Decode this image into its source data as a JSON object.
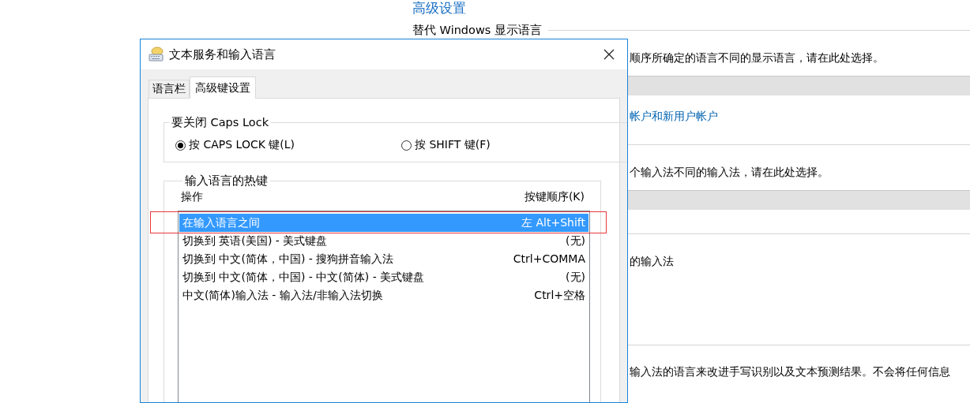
{
  "background_page": {
    "heading": "高级设置",
    "section_title": "替代 Windows 显示语言",
    "items": [
      {
        "kind": "text",
        "text": "顺序所确定的语言不同的显示语言，请在此处选择。"
      },
      {
        "kind": "band"
      },
      {
        "kind": "link",
        "text": "帐户和新用户帐户"
      },
      {
        "kind": "rule"
      },
      {
        "kind": "text",
        "text": "个输入法不同的输入法，请在此处选择。"
      },
      {
        "kind": "band"
      },
      {
        "kind": "rule"
      },
      {
        "kind": "text",
        "text": "的输入法"
      },
      {
        "kind": "rule"
      },
      {
        "kind": "text",
        "text": "输入法的语言来改进手写识别以及文本预测结果。不会将任何信息"
      }
    ]
  },
  "dialog": {
    "title": "文本服务和输入语言",
    "tabs": [
      {
        "label": "语言栏",
        "selected": false
      },
      {
        "label": "高级键设置",
        "selected": true
      }
    ],
    "caps_lock_group": {
      "title": "要关闭 Caps Lock",
      "options": [
        {
          "label": "按 CAPS LOCK 键(L)",
          "selected": true
        },
        {
          "label": "按 SHIFT 键(F)",
          "selected": false
        }
      ]
    },
    "hotkeys_group": {
      "title": "输入语言的热键",
      "columns": [
        "操作",
        "按键顺序(K)"
      ],
      "rows": [
        {
          "action": "在输入语言之间",
          "keys": "左 Alt+Shift",
          "selected": true
        },
        {
          "action": "切换到 英语(美国) - 美式键盘",
          "keys": "(无)",
          "selected": false
        },
        {
          "action": "切换到 中文(简体，中国) - 搜狗拼音输入法",
          "keys": "Ctrl+COMMA",
          "selected": false
        },
        {
          "action": "切换到 中文(简体，中国) - 中文(简体) - 美式键盘",
          "keys": "(无)",
          "selected": false
        },
        {
          "action": "中文(简体)输入法 - 输入法/非输入法切换",
          "keys": "Ctrl+空格",
          "selected": false
        }
      ]
    },
    "annotation_box": true
  }
}
